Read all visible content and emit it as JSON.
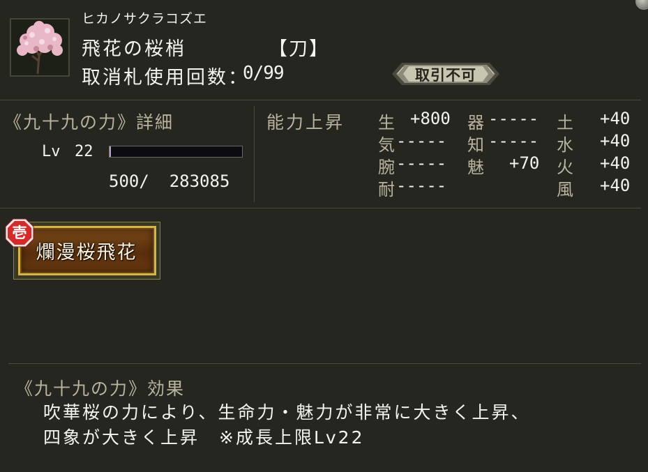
{
  "item": {
    "reading": "ヒカノサクラコズエ",
    "name": "飛花の桜梢",
    "type": "【刀】",
    "cancel_label": "取消札使用回数：",
    "cancel_value": "0/99",
    "trade_badge": "取引不可",
    "image_icon": "cherry-blossom-tree-icon"
  },
  "detail": {
    "title": "《九十九の力》詳細",
    "lv_label": "Lv",
    "lv_value": "22",
    "exp_current": "500/",
    "exp_total": "283085",
    "exp_progress": 0.002
  },
  "ability": {
    "title": "能力上昇",
    "col1": [
      {
        "label": "生",
        "value": "+800"
      },
      {
        "label": "気",
        "value": "-----"
      },
      {
        "label": "腕",
        "value": "-----"
      },
      {
        "label": "耐",
        "value": "-----"
      }
    ],
    "col2": [
      {
        "label": "器",
        "value": "-----"
      },
      {
        "label": "知",
        "value": "-----"
      },
      {
        "label": "魅",
        "value": "+70"
      }
    ],
    "col3": [
      {
        "label": "土",
        "value": "+40"
      },
      {
        "label": "水",
        "value": "+40"
      },
      {
        "label": "火",
        "value": "+40"
      },
      {
        "label": "風",
        "value": "+40"
      }
    ]
  },
  "skill": {
    "badge": "壱",
    "name": "爛漫桜飛花"
  },
  "effect": {
    "title": "《九十九の力》効果",
    "line1": "吹華桜の力により、生命力・魅力が非常に大きく上昇、",
    "line2": "四象が大きく上昇　※成長上限Lv22"
  },
  "colors": {
    "background": "#262621",
    "label_gold": "#b8b39c",
    "skill_border": "#d6b448",
    "badge_red": "#d42a2a"
  }
}
